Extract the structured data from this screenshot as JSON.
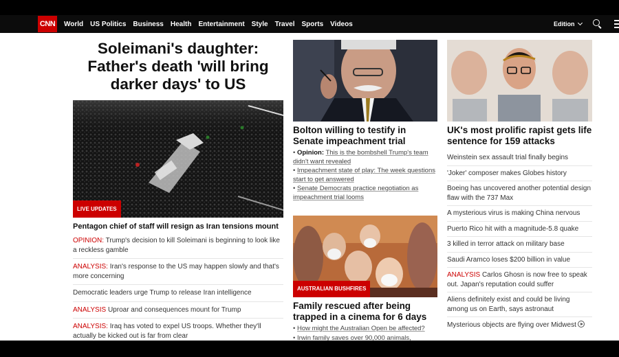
{
  "nav": {
    "logo": "CNN",
    "links": [
      "World",
      "US Politics",
      "Business",
      "Health",
      "Entertainment",
      "Style",
      "Travel",
      "Sports",
      "Videos"
    ],
    "edition": "Edition"
  },
  "lead": {
    "headline": "Soleimani's daughter: Father's death 'will bring darker days' to US",
    "tag": "LIVE UPDATES",
    "caption": "Pentagon chief of staff will resign as Iran tensions mount",
    "links": [
      {
        "prefix": "OPINION:",
        "text": "Trump's decision to kill Soleimani is beginning to look like a reckless gamble"
      },
      {
        "prefix": "ANALYSIS:",
        "text": "Iran's response to the US may happen slowly and that's more concerning"
      },
      {
        "prefix": "",
        "text": "Democratic leaders urge Trump to release Iran intelligence"
      },
      {
        "prefix": "ANALYSIS",
        "text": "Uproar and consequences mount for Trump"
      },
      {
        "prefix": "ANALYSIS:",
        "text": "Iraq has voted to expel US troops. Whether they'll actually be kicked out is far from clear"
      }
    ]
  },
  "middle": {
    "story1": {
      "title": "Bolton willing to testify in Senate impeachment trial",
      "items": [
        {
          "bold": "Opinion:",
          "text": "This is the bombshell Trump's team didn't want revealed"
        },
        {
          "bold": "",
          "text": "Impeachment state of play: The week questions start to get answered"
        },
        {
          "bold": "",
          "text": "Senate Democrats practice negotiation as impeachment trial looms"
        }
      ]
    },
    "story2": {
      "tag": "AUSTRALIAN BUSHFIRES",
      "title": "Family rescued after being trapped in a cinema for 6 days",
      "items": [
        {
          "text": "How might the Australian Open be affected?"
        },
        {
          "text": "Irwin family saves over 90,000 animals,"
        }
      ]
    }
  },
  "right": {
    "title": "UK's most prolific rapist gets life sentence for 159 attacks",
    "items": [
      {
        "prefix": "",
        "text": "Weinstein sex assault trial finally begins"
      },
      {
        "prefix": "",
        "text": "'Joker' composer makes Globes history"
      },
      {
        "prefix": "",
        "text": "Boeing has uncovered another potential design flaw with the 737 Max"
      },
      {
        "prefix": "",
        "text": "A mysterious virus is making China nervous"
      },
      {
        "prefix": "",
        "text": "Puerto Rico hit with a magnitude-5.8 quake"
      },
      {
        "prefix": "",
        "text": "3 killed in terror attack on military base"
      },
      {
        "prefix": "",
        "text": "Saudi Aramco loses $200 billion in value"
      },
      {
        "prefix": "ANALYSIS",
        "text": "Carlos Ghosn is now free to speak out. Japan's reputation could suffer"
      },
      {
        "prefix": "",
        "text": "Aliens definitely exist and could be living among us on Earth, says astronaut"
      },
      {
        "prefix": "",
        "text": "Mysterious objects are flying over Midwest"
      }
    ]
  },
  "colors": {
    "brand": "#cc0000",
    "nav_bg": "#0c0c0c"
  }
}
